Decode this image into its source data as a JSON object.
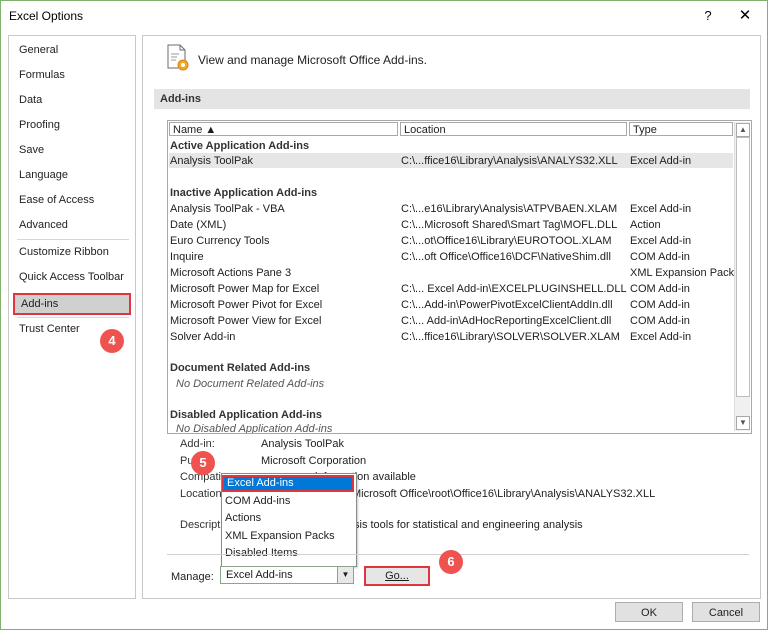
{
  "window": {
    "title": "Excel Options",
    "help": "?",
    "close": "✕"
  },
  "sidebar": {
    "items": [
      "General",
      "Formulas",
      "Data",
      "Proofing",
      "Save",
      "Language",
      "Ease of Access",
      "Advanced",
      "Customize Ribbon",
      "Quick Access Toolbar",
      "Add-ins",
      "Trust Center"
    ],
    "selected": "Add-ins"
  },
  "badges": [
    "4",
    "5",
    "6"
  ],
  "main": {
    "header": "View and manage Microsoft Office Add-ins.",
    "section": "Add-ins"
  },
  "table": {
    "headers": [
      "Name ▲",
      "Location",
      "Type"
    ],
    "groups": {
      "active": "Active Application Add-ins",
      "inactive": "Inactive Application Add-ins",
      "document": "Document Related Add-ins",
      "document_empty": "No Document Related Add-ins",
      "disabled": "Disabled Application Add-ins",
      "disabled_empty": "No Disabled Application Add-ins"
    },
    "active_rows": [
      {
        "name": "Analysis ToolPak",
        "location": "C:\\...ffice16\\Library\\Analysis\\ANALYS32.XLL",
        "type": "Excel Add-in"
      }
    ],
    "inactive_rows": [
      {
        "name": "Analysis ToolPak - VBA",
        "location": "C:\\...e16\\Library\\Analysis\\ATPVBAEN.XLAM",
        "type": "Excel Add-in"
      },
      {
        "name": "Date (XML)",
        "location": "C:\\...Microsoft Shared\\Smart Tag\\MOFL.DLL",
        "type": "Action"
      },
      {
        "name": "Euro Currency Tools",
        "location": "C:\\...ot\\Office16\\Library\\EUROTOOL.XLAM",
        "type": "Excel Add-in"
      },
      {
        "name": "Inquire",
        "location": "C:\\...oft Office\\Office16\\DCF\\NativeShim.dll",
        "type": "COM Add-in"
      },
      {
        "name": "Microsoft Actions Pane 3",
        "location": "",
        "type": "XML Expansion Pack"
      },
      {
        "name": "Microsoft Power Map for Excel",
        "location": "C:\\... Excel Add-in\\EXCELPLUGINSHELL.DLL",
        "type": "COM Add-in"
      },
      {
        "name": "Microsoft Power Pivot for Excel",
        "location": "C:\\...Add-in\\PowerPivotExcelClientAddIn.dll",
        "type": "COM Add-in"
      },
      {
        "name": "Microsoft Power View for Excel",
        "location": "C:\\... Add-in\\AdHocReportingExcelClient.dll",
        "type": "COM Add-in"
      },
      {
        "name": "Solver Add-in",
        "location": "C:\\...ffice16\\Library\\SOLVER\\SOLVER.XLAM",
        "type": "Excel Add-in"
      }
    ]
  },
  "details": {
    "addin_label": "Add-in:",
    "addin_value": "Analysis ToolPak",
    "publisher_label": "Pu",
    "publisher_value": "Microsoft Corporation",
    "compat_label": "Compati",
    "compat_value": "information available",
    "location_label": "Location",
    "location_value": "Microsoft Office\\root\\Office16\\Library\\Analysis\\ANALYS32.XLL",
    "desc_label": "Descript",
    "desc_value": "sis tools for statistical and engineering analysis"
  },
  "manage": {
    "label": "Manage:",
    "value": "Excel Add-ins",
    "options": [
      "Excel Add-ins",
      "COM Add-ins",
      "Actions",
      "XML Expansion Packs",
      "Disabled Items"
    ],
    "go": "Go..."
  },
  "buttons": {
    "ok": "OK",
    "cancel": "Cancel"
  }
}
